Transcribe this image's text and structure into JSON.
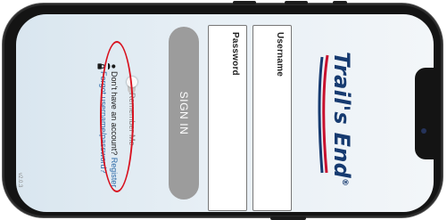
{
  "login": {
    "username_label": "Username",
    "password_label": "Password",
    "signin_label": "SIGN IN",
    "remember_label": "Remember Me",
    "remember_checked": false,
    "account_prompt": "Don't have an account? ",
    "register_link": "Register",
    "forgot_link": "Forgot username/password?",
    "version": "v2.0.3"
  },
  "brand": {
    "logo_text": "Trail's End",
    "trademark": "®",
    "logo_color": "#163a70",
    "swoosh_red": "#c8102e",
    "swoosh_blue": "#163a70"
  },
  "annotation": {
    "highlight_color": "#d8121f"
  },
  "icons": {
    "account": "person-icon",
    "forgot": "lock-icon"
  }
}
